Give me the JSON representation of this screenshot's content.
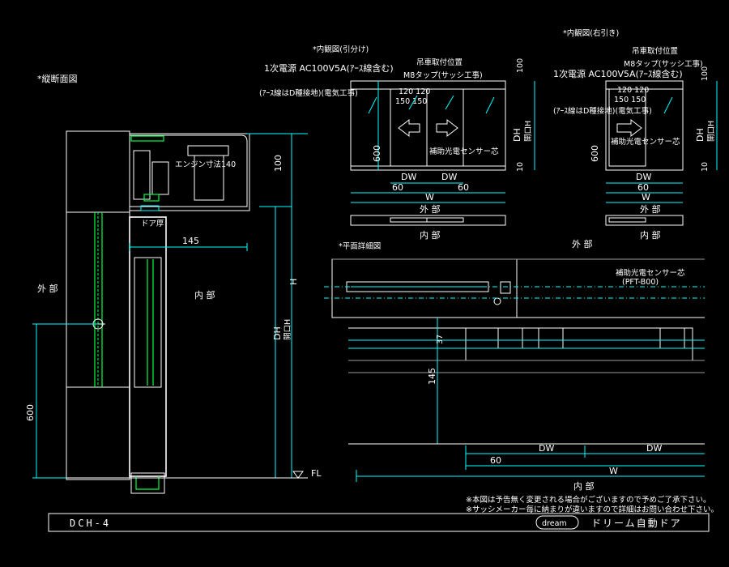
{
  "colors": {
    "background": "#000000",
    "line": "#ffffff",
    "dimension": "#00ffff",
    "accent": "#00ff44",
    "hidden": "#ffff00"
  },
  "section": {
    "title": "*縦断面図",
    "outside": "外 部",
    "inside": "内 部",
    "engine_dim": "エンジン寸法140",
    "door_thickness": "ドア厚",
    "dim_145": "145",
    "dim_100": "100",
    "dim_H": "H",
    "dim_DH": "DH",
    "dim_DH2": "開口H",
    "dim_600": "600",
    "fl": "FL"
  },
  "elev_left": {
    "title": "*内観図(引分け)",
    "power": "1次電源 AC100V5A(ｱｰｽ線含む)",
    "earth": "(ｱｰｽ線はD種接地)(電気工事)",
    "hanger": "吊車取付位置",
    "tap": "M8タップ(サッシ工事)",
    "dims_top": "120 120",
    "dims_top2": "150 150",
    "sensor": "補助光電センサー芯",
    "dw1": "DW",
    "dw2": "DW",
    "d60a": "60",
    "d60b": "60",
    "w": "W",
    "outside": "外 部",
    "inside": "内 部",
    "d600": "600",
    "d10": "10",
    "d100": "100",
    "dh": "DH",
    "dh2": "開口H"
  },
  "elev_right": {
    "title": "*内観図(右引き)",
    "hanger": "吊車取付位置",
    "tap": "M8タップ(サッシ工事)",
    "power": "1次電源 AC100V5A(ｱｰｽ線含む)",
    "earth": "(ｱｰｽ線はD種接地)(電気工事)",
    "dims_top": "120 120",
    "dims_top2": "150 150",
    "sensor": "補助光電センサー芯",
    "dw": "DW",
    "d60": "60",
    "w": "W",
    "outside": "外 部",
    "inside": "内 部",
    "d600": "600",
    "d10": "10",
    "d100": "100",
    "dh": "DH",
    "dh2": "開口H"
  },
  "plan": {
    "title": "*平面詳細図",
    "outside": "外 部",
    "sensor": "補助光電センサー芯",
    "sensor_code": "(PFT-B00)",
    "d145": "145",
    "d37": "37",
    "dw1": "DW",
    "dw2": "DW",
    "d60": "60",
    "w": "W",
    "inside": "内 部"
  },
  "notes": {
    "line1": "※本図は予告無く変更される場合がございますので予めご了承下さい。",
    "line2": "※サッシメーカー毎に納まりが違いますので詳細はお問い合わせ下さい。"
  },
  "footer": {
    "code": "DCH-4",
    "logo": "dream",
    "product": "ドリーム自動ドア"
  }
}
